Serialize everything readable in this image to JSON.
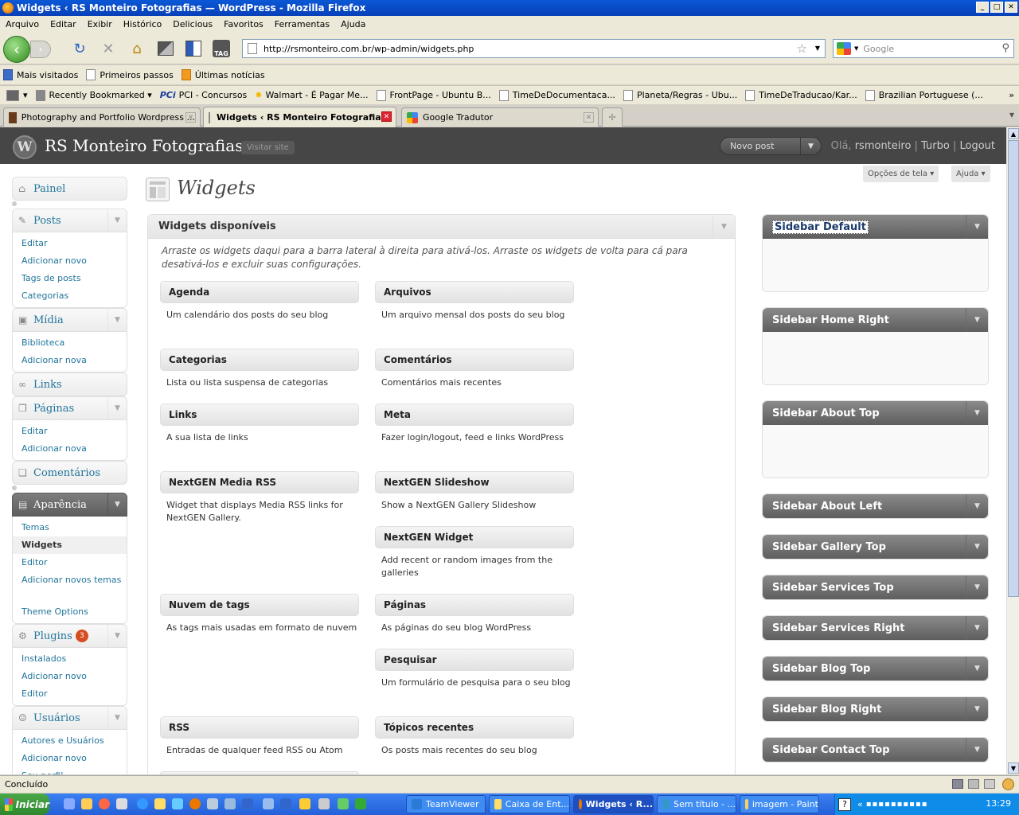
{
  "window": {
    "title": "Widgets ‹ RS Monteiro Fotografias — WordPress - Mozilla Firefox"
  },
  "menu": [
    "Arquivo",
    "Editar",
    "Exibir",
    "Histórico",
    "Delicious",
    "Favoritos",
    "Ferramentas",
    "Ajuda"
  ],
  "nav": {
    "url": "http://rsmonteiro.com.br/wp-admin/widgets.php",
    "search_placeholder": "Google"
  },
  "bookmarks1": [
    "Mais visitados",
    "Primeiros passos",
    "Últimas notícias"
  ],
  "bookmarks2": [
    "Recently Bookmarked",
    "PCI - Concursos",
    "Walmart - É Pagar Me...",
    "FrontPage - Ubuntu B...",
    "TimeDeDocumentaca...",
    "Planeta/Regras - Ubu...",
    "TimeDeTraducao/Kar...",
    "Brazilian Portuguese (..."
  ],
  "tabs": [
    {
      "label": "Photography and Portfolio Wordpress ..."
    },
    {
      "label": "Widgets ‹ RS Monteiro Fotografia..."
    },
    {
      "label": "Google Tradutor"
    }
  ],
  "wp": {
    "site_name": "RS Monteiro Fotografias",
    "visit_site": "Visitar site",
    "novo_post": "Novo post",
    "greeting": "Olá,",
    "username": "rsmonteiro",
    "turbo": "Turbo",
    "logout": "Logout",
    "screen_options": "Opções de tela ▾",
    "help": "Ajuda ▾",
    "page_title": "Widgets"
  },
  "adminmenu": {
    "painel": "Painel",
    "posts": "Posts",
    "posts_sub": [
      "Editar",
      "Adicionar novo",
      "Tags de posts",
      "Categorias"
    ],
    "midia": "Mídia",
    "midia_sub": [
      "Biblioteca",
      "Adicionar nova"
    ],
    "links": "Links",
    "paginas": "Páginas",
    "paginas_sub": [
      "Editar",
      "Adicionar nova"
    ],
    "comentarios": "Comentários",
    "aparencia": "Aparência",
    "aparencia_sub": [
      "Temas",
      "Widgets",
      "Editor",
      "Adicionar novos temas",
      "Theme Options"
    ],
    "plugins": "Plugins",
    "plugins_count": "3",
    "plugins_sub": [
      "Instalados",
      "Adicionar novo",
      "Editor"
    ],
    "usuarios": "Usuários",
    "usuarios_sub": [
      "Autores e Usuários",
      "Adicionar novo",
      "Seu perfil"
    ]
  },
  "available": {
    "title": "Widgets disponíveis",
    "description": "Arraste os widgets daqui para a barra lateral à direita para ativá-los. Arraste os widgets de volta para cá para desativá-los e excluir suas configurações.",
    "widgets": [
      {
        "name": "Agenda",
        "desc": "Um calendário dos posts do seu blog"
      },
      {
        "name": "Arquivos",
        "desc": "Um arquivo mensal dos posts do seu blog"
      },
      {
        "name": "Categorias",
        "desc": "Lista ou lista suspensa de categorias"
      },
      {
        "name": "Comentários",
        "desc": "Comentários mais recentes"
      },
      {
        "name": "Links",
        "desc": "A sua lista de links"
      },
      {
        "name": "Meta",
        "desc": "Fazer login/logout, feed e links WordPress"
      },
      {
        "name": "NextGEN Media RSS",
        "desc": "Widget that displays Media RSS links for NextGEN Gallery."
      },
      {
        "name": "NextGEN Slideshow",
        "desc": "Show a NextGEN Gallery Slideshow"
      },
      {
        "name": "NextGEN Widget",
        "desc": "Add recent or random images from the galleries"
      },
      {
        "name": "Nuvem de tags",
        "desc": "As tags mais usadas em formato de nuvem"
      },
      {
        "name": "Páginas",
        "desc": "As páginas do seu blog WordPress"
      },
      {
        "name": "Pesquisar",
        "desc": "Um formulário de pesquisa para o seu blog"
      },
      {
        "name": "RSS",
        "desc": "Entradas de qualquer feed RSS ou Atom"
      },
      {
        "name": "Tópicos recentes",
        "desc": "Os posts mais recentes do seu blog"
      }
    ]
  },
  "sidebars": [
    "Sidebar Default",
    "Sidebar Home Right",
    "Sidebar About Top",
    "Sidebar About Left",
    "Sidebar Gallery Top",
    "Sidebar Services Top",
    "Sidebar Services Right",
    "Sidebar Blog Top",
    "Sidebar Blog Right",
    "Sidebar Contact Top"
  ],
  "status": "Concluído",
  "taskbar": {
    "start": "Iniciar",
    "tasks": [
      "TeamViewer",
      "Caixa de Ent...",
      "Widgets ‹ R...",
      "Sem título - ...",
      "imagem - Paint"
    ],
    "clock": "13:29"
  }
}
